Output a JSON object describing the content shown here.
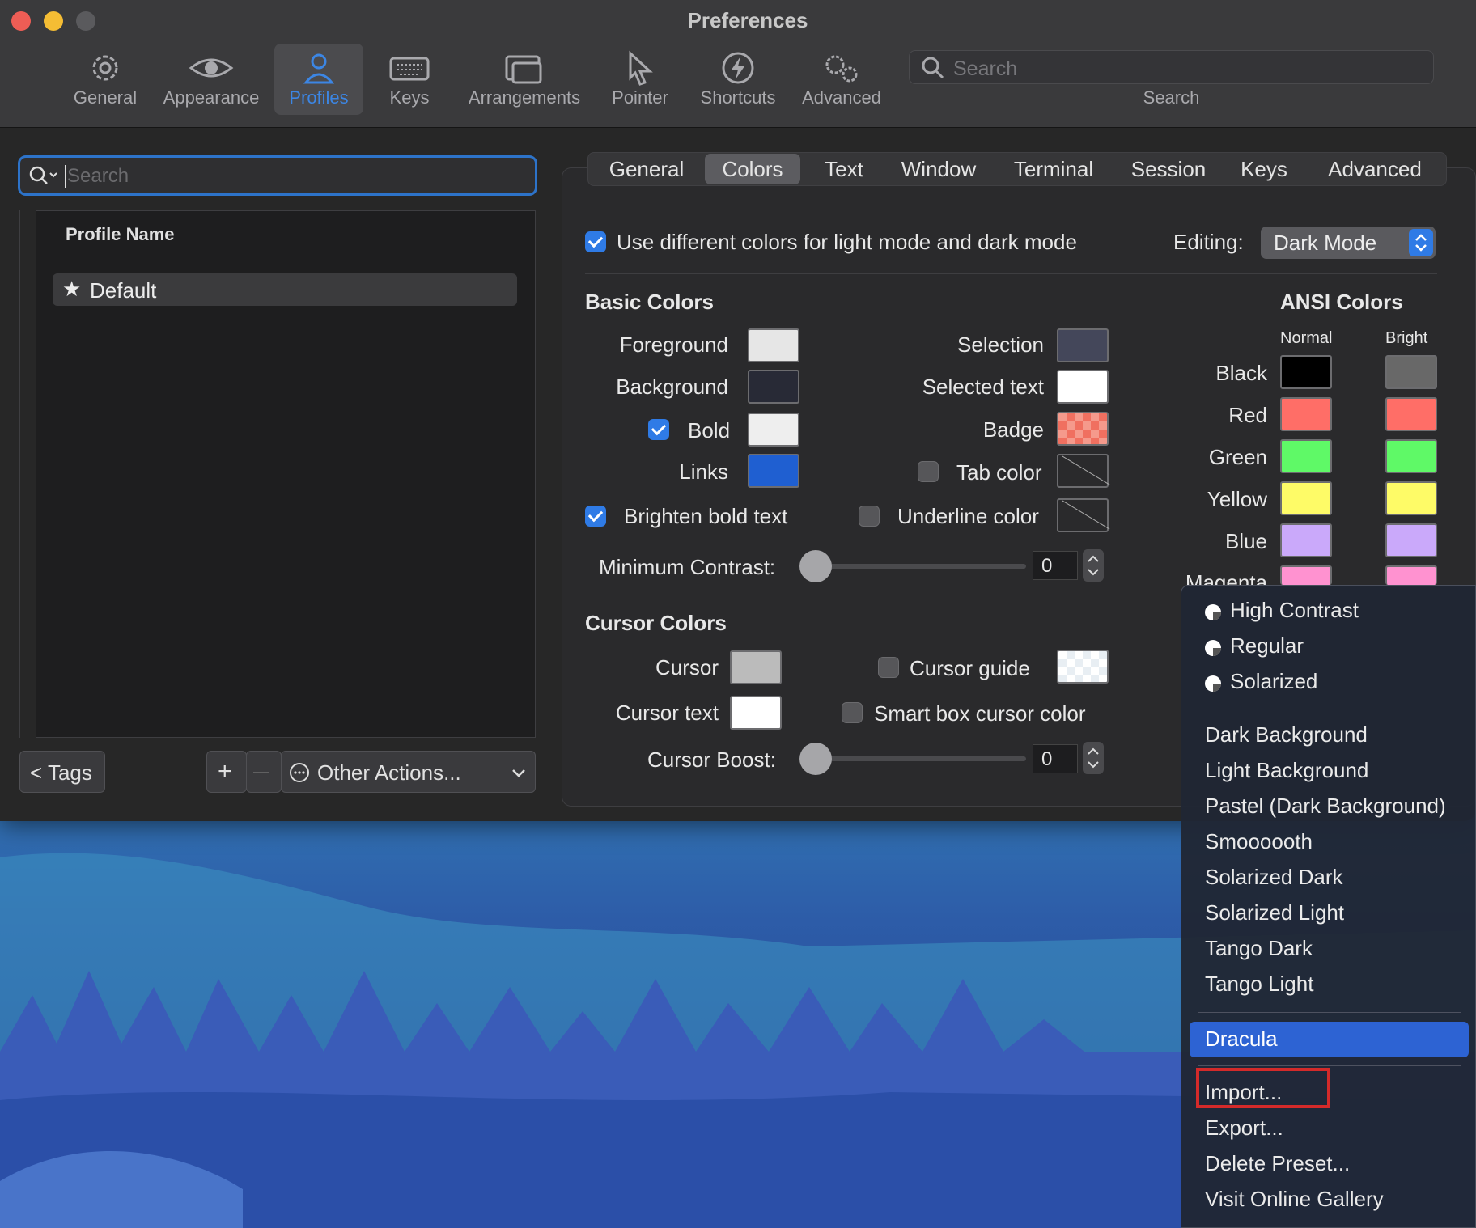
{
  "window": {
    "title": "Preferences"
  },
  "toolbar": {
    "items": [
      {
        "label": "General",
        "icon": "gear-icon"
      },
      {
        "label": "Appearance",
        "icon": "eye-icon"
      },
      {
        "label": "Profiles",
        "icon": "person-icon"
      },
      {
        "label": "Keys",
        "icon": "keyboard-icon"
      },
      {
        "label": "Arrangements",
        "icon": "windows-icon"
      },
      {
        "label": "Pointer",
        "icon": "pointer-icon"
      },
      {
        "label": "Shortcuts",
        "icon": "bolt-icon"
      },
      {
        "label": "Advanced",
        "icon": "gears-icon"
      }
    ],
    "selected": "Profiles",
    "search_placeholder": "Search",
    "search_label": "Search"
  },
  "profiles": {
    "search_placeholder": "Search",
    "column_header": "Profile Name",
    "rows": [
      {
        "name": "Default",
        "starred": true
      }
    ],
    "tags_label": "< Tags",
    "add_label": "+",
    "remove_label": "—",
    "other_actions_label": "Other Actions..."
  },
  "tabs": {
    "items": [
      "General",
      "Colors",
      "Text",
      "Window",
      "Terminal",
      "Session",
      "Keys",
      "Advanced"
    ],
    "selected": "Colors"
  },
  "colors": {
    "mode_checkbox_label": "Use different colors for light mode and dark mode",
    "mode_checked": true,
    "editing_label": "Editing:",
    "editing_value": "Dark Mode",
    "basic_header": "Basic Colors",
    "foreground_label": "Foreground",
    "background_label": "Background",
    "bold_label": "Bold",
    "bold_checked": true,
    "links_label": "Links",
    "selection_label": "Selection",
    "selected_text_label": "Selected text",
    "badge_label": "Badge",
    "tab_color_label": "Tab color",
    "brighten_label": "Brighten bold text",
    "brighten_checked": true,
    "underline_label": "Underline color",
    "min_contrast_label": "Minimum Contrast:",
    "min_contrast_value": "0",
    "cursor_header": "Cursor Colors",
    "cursor_label": "Cursor",
    "cursor_text_label": "Cursor text",
    "cursor_guide_label": "Cursor guide",
    "smart_box_label": "Smart box cursor color",
    "cursor_boost_label": "Cursor Boost:",
    "cursor_boost_value": "0",
    "ansi_header": "ANSI Colors",
    "ansi_normal": "Normal",
    "ansi_bright": "Bright",
    "ansi_rows": [
      {
        "name": "Black",
        "normal": "#000000",
        "bright": "#686868"
      },
      {
        "name": "Red",
        "normal": "#ff6e67",
        "bright": "#ff6e67"
      },
      {
        "name": "Green",
        "normal": "#5ff967",
        "bright": "#5ff967"
      },
      {
        "name": "Yellow",
        "normal": "#fefb67",
        "bright": "#fefb67"
      },
      {
        "name": "Blue",
        "normal": "#caa9fa",
        "bright": "#caa9fa"
      },
      {
        "name": "Magenta",
        "normal": "#ff92d0",
        "bright": "#ff92d0"
      }
    ],
    "swatches": {
      "foreground": "#e6e6e6",
      "background": "#282a36",
      "bold": "#eeeeee",
      "links": "#1f5fd1",
      "selection": "#44475a",
      "selected_text": "#ffffff",
      "badge": "#f07060",
      "cursor": "#bbbbbb",
      "cursor_text": "#ffffff"
    }
  },
  "preset_menu": {
    "radio_items": [
      "High Contrast",
      "Regular",
      "Solarized"
    ],
    "presets": [
      "Dark Background",
      "Light Background",
      "Pastel (Dark Background)",
      "Smoooooth",
      "Solarized Dark",
      "Solarized Light",
      "Tango Dark",
      "Tango Light"
    ],
    "highlighted": "Dracula",
    "actions": [
      "Import...",
      "Export...",
      "Delete Preset...",
      "Visit Online Gallery"
    ]
  }
}
